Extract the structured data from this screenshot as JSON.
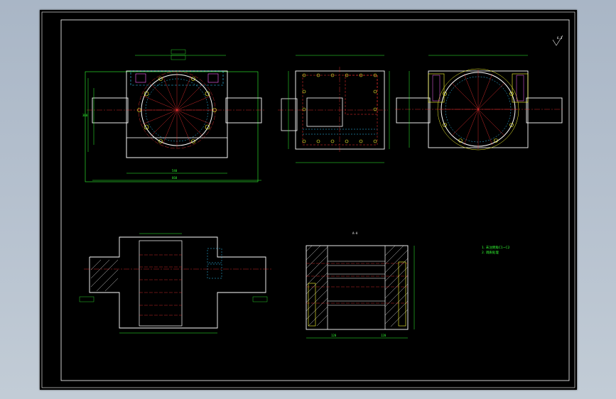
{
  "drawing": {
    "background": "#000000",
    "colors": {
      "outline": "#ffffff",
      "dimension": "#33ff33",
      "center_line": "#ff3333",
      "hidden_line": "#33ccff",
      "hole": "#ffff33",
      "accent": "#ff66ff"
    },
    "labels": {
      "section_mark": "A-A",
      "view_label": "B",
      "roughness": "6.3",
      "dim_width_total": "660",
      "dim_width_inner": "540",
      "dim_height": "360",
      "dim_bottom_a": "120",
      "dim_bottom_b": "120"
    },
    "notes": {
      "line1": "1. 未注倒角C1~C2",
      "line2": "2. 调质处理"
    }
  }
}
